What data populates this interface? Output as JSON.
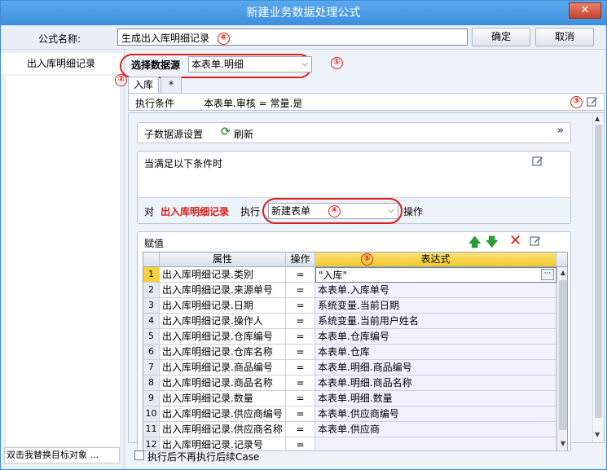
{
  "window": {
    "title": "新建业务数据处理公式",
    "close_glyph": "✕"
  },
  "formula": {
    "label": "公式名称:",
    "value": "生成出入库明细记录",
    "badge": "⑥"
  },
  "buttons": {
    "ok": "确定",
    "cancel": "取消"
  },
  "left": {
    "item": "出入库明细记录",
    "bottom_hint": "双击我替换目标对象 ..."
  },
  "datasource": {
    "label": "选择数据源",
    "value": "本表单.明细",
    "badge": "①"
  },
  "tabs": {
    "badge": "②",
    "items": [
      "入库",
      "*"
    ]
  },
  "condition": {
    "label": "执行条件",
    "value": "本表单.审核 = 常量.是",
    "badge": "③"
  },
  "sub_datasource": {
    "label": "子数据源设置",
    "refresh": "刷新"
  },
  "when": {
    "label": "当满足以下条件时"
  },
  "action": {
    "prefix": "对",
    "target": "出入库明细记录",
    "exec": "执行",
    "select_value": "新建表单",
    "suffix": "操作",
    "badge": "④"
  },
  "assign": {
    "label": "赋值",
    "badge": "⑤"
  },
  "grid": {
    "headers": [
      "属性",
      "操作",
      "表达式"
    ],
    "rows": [
      {
        "n": "1",
        "prop": "出入库明细记录.类别",
        "op": "=",
        "expr": "\"入库\""
      },
      {
        "n": "2",
        "prop": "出入库明细记录.来源单号",
        "op": "=",
        "expr": "本表单.入库单号"
      },
      {
        "n": "3",
        "prop": "出入库明细记录.日期",
        "op": "=",
        "expr": "系统变量.当前日期"
      },
      {
        "n": "4",
        "prop": "出入库明细记录.操作人",
        "op": "=",
        "expr": "系统变量.当前用户姓名"
      },
      {
        "n": "5",
        "prop": "出入库明细记录.仓库编号",
        "op": "=",
        "expr": "本表单.仓库编号"
      },
      {
        "n": "6",
        "prop": "出入库明细记录.仓库名称",
        "op": "=",
        "expr": "本表单.仓库"
      },
      {
        "n": "7",
        "prop": "出入库明细记录.商品编号",
        "op": "=",
        "expr": "本表单.明细.商品编号"
      },
      {
        "n": "8",
        "prop": "出入库明细记录.商品名称",
        "op": "=",
        "expr": "本表单.明细.商品名称"
      },
      {
        "n": "9",
        "prop": "出入库明细记录.数量",
        "op": "=",
        "expr": "本表单.明细.数量"
      },
      {
        "n": "10",
        "prop": "出入库明细记录.供应商编号",
        "op": "=",
        "expr": "本表单.供应商编号"
      },
      {
        "n": "11",
        "prop": "出入库明细记录.供应商名称",
        "op": "=",
        "expr": "本表单.供应商"
      },
      {
        "n": "12",
        "prop": "出入库明细记录.记录号",
        "op": "=",
        "expr": ""
      }
    ]
  },
  "footer": {
    "checkbox_label": "执行后不再执行后续Case"
  },
  "colors": {
    "title_bar": "#3b8fdc",
    "accent_red": "#d9201a",
    "header_yellow": "#f7d23a"
  }
}
